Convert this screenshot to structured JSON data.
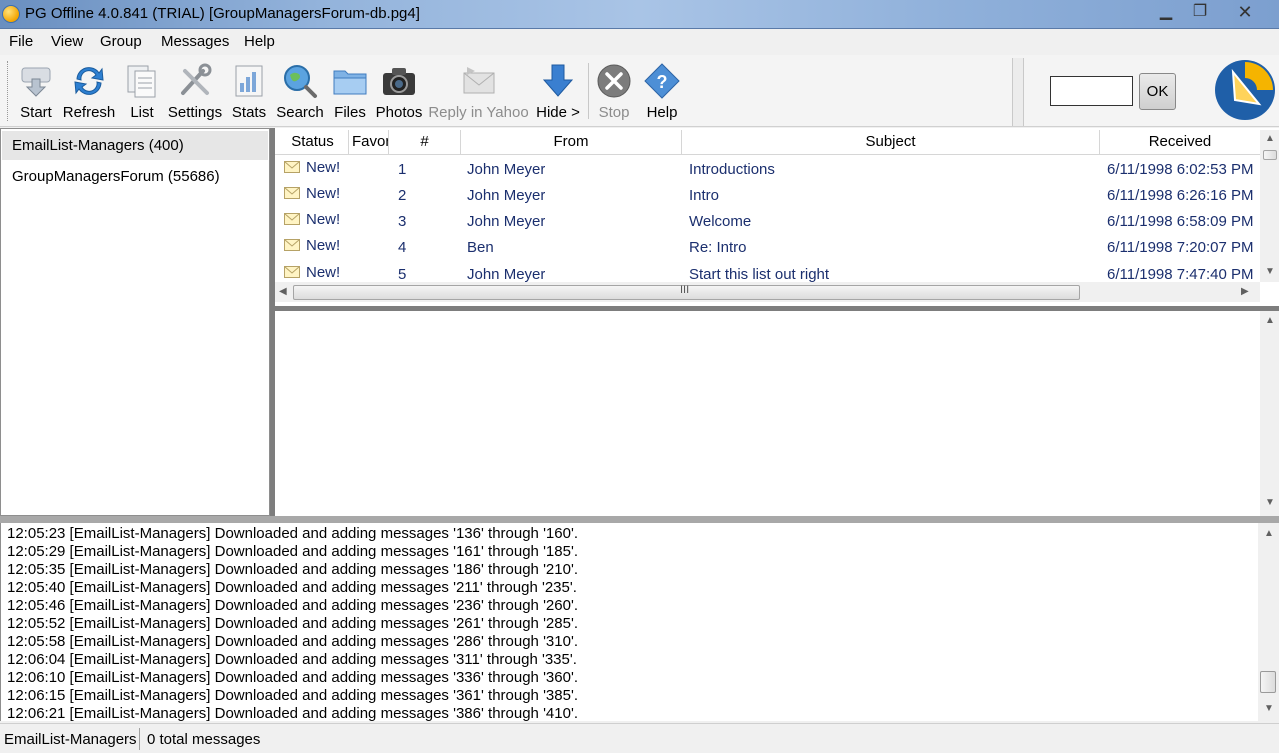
{
  "window": {
    "title": "PG Offline 4.0.841 (TRIAL) [GroupManagersForum-db.pg4]",
    "minimize": "▁",
    "maximize": "❐",
    "close": "✕"
  },
  "menu": [
    "File",
    "View",
    "Group",
    "Messages",
    "Help"
  ],
  "toolbar": {
    "start": "Start",
    "refresh": "Refresh",
    "list": "List",
    "settings": "Settings",
    "stats": "Stats",
    "search": "Search",
    "files": "Files",
    "photos": "Photos",
    "reply_yahoo": "Reply in Yahoo",
    "hide": "Hide >",
    "stop": "Stop",
    "help": "Help",
    "search_value": "",
    "ok": "OK"
  },
  "groups": [
    {
      "label": "EmailList-Managers (400)",
      "selected": true
    },
    {
      "label": "GroupManagersForum (55686)",
      "selected": false
    }
  ],
  "messages": {
    "columns": [
      "Status",
      "Favor",
      "#",
      "From",
      "Subject",
      "Received"
    ],
    "rows": [
      {
        "status": "New!",
        "num": "1",
        "from": "John Meyer",
        "subject": "Introductions",
        "received": "6/11/1998 6:02:53 PM"
      },
      {
        "status": "New!",
        "num": "2",
        "from": "John Meyer",
        "subject": "Intro",
        "received": "6/11/1998 6:26:16 PM"
      },
      {
        "status": "New!",
        "num": "3",
        "from": "John Meyer",
        "subject": "Welcome",
        "received": "6/11/1998 6:58:09 PM"
      },
      {
        "status": "New!",
        "num": "4",
        "from": "Ben",
        "subject": "Re: Intro",
        "received": "6/11/1998 7:20:07 PM"
      },
      {
        "status": "New!",
        "num": "5",
        "from": "John Meyer",
        "subject": "Start this list out right",
        "received": "6/11/1998 7:47:40 PM"
      }
    ],
    "hscroll_grip": "III"
  },
  "log": [
    "12:05:23 [EmailList-Managers] Downloaded and adding messages '136' through '160'.",
    "12:05:29 [EmailList-Managers] Downloaded and adding messages '161' through '185'.",
    "12:05:35 [EmailList-Managers] Downloaded and adding messages '186' through '210'.",
    "12:05:40 [EmailList-Managers] Downloaded and adding messages '211' through '235'.",
    "12:05:46 [EmailList-Managers] Downloaded and adding messages '236' through '260'.",
    "12:05:52 [EmailList-Managers] Downloaded and adding messages '261' through '285'.",
    "12:05:58 [EmailList-Managers] Downloaded and adding messages '286' through '310'.",
    "12:06:04 [EmailList-Managers] Downloaded and adding messages '311' through '335'.",
    "12:06:10 [EmailList-Managers] Downloaded and adding messages '336' through '360'.",
    "12:06:15 [EmailList-Managers] Downloaded and adding messages '361' through '385'.",
    "12:06:21 [EmailList-Managers] Downloaded and adding messages '386' through '410'."
  ],
  "status": {
    "group": "EmailList-Managers",
    "count": "0 total messages"
  },
  "colors": {
    "link_text": "#1b2f6e",
    "title_gradient": "#93b3db",
    "splitter": "#7d7d7d"
  }
}
